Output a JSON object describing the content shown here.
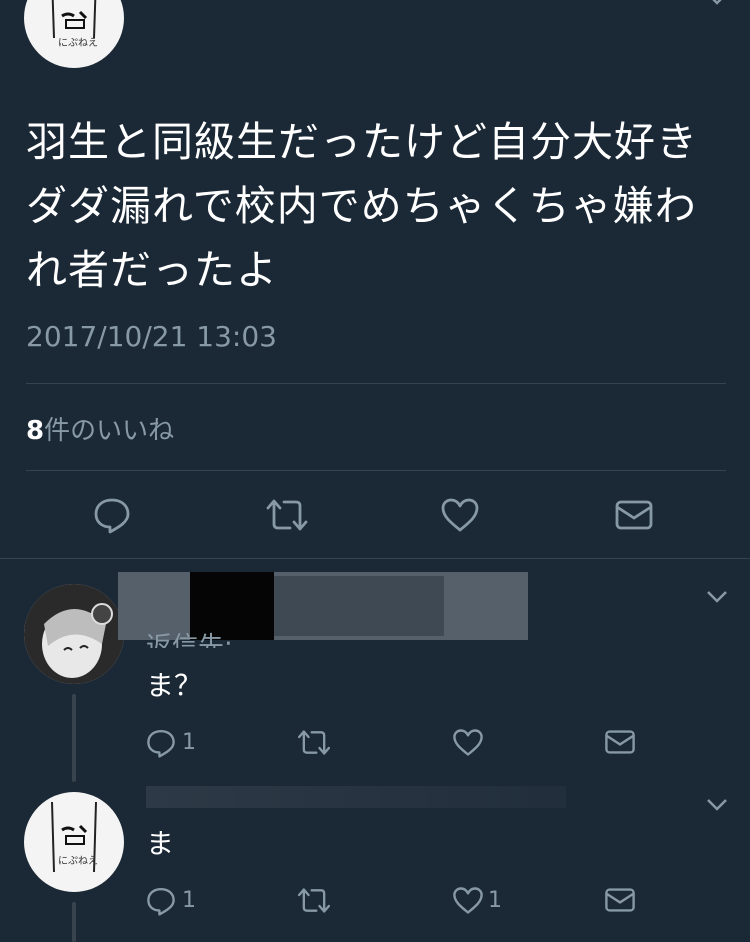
{
  "tweet": {
    "text": "羽生と同級生だったけど自分大好きダダ漏れで校内でめちゃくちゃ嫌われ者だったよ",
    "timestamp": "2017/10/21 13:03",
    "likes_count": "8",
    "likes_label": "件のいいね"
  },
  "replies": [
    {
      "reply_to": "返信先:",
      "text": "ま？",
      "reply_count": "1",
      "like_count": ""
    },
    {
      "text": "ま",
      "reply_count": "1",
      "like_count": "1"
    }
  ],
  "icons": [
    "reply-icon",
    "retweet-icon",
    "like-icon",
    "dm-icon",
    "chevron-down-icon"
  ],
  "colors": {
    "background": "#1b2836",
    "secondary_text": "#8899a6",
    "divider": "#38444d"
  }
}
